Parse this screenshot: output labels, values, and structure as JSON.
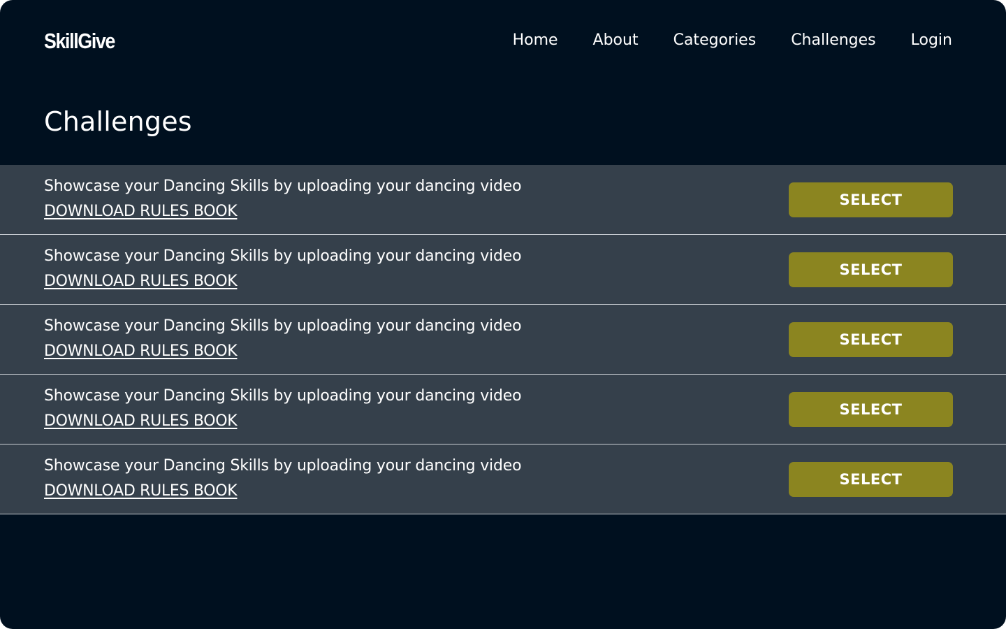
{
  "brand": {
    "name": "SkillGive"
  },
  "nav": {
    "items": [
      {
        "label": "Home"
      },
      {
        "label": "About"
      },
      {
        "label": "Categories"
      },
      {
        "label": "Challenges"
      },
      {
        "label": "Login"
      }
    ]
  },
  "page": {
    "title": "Challenges"
  },
  "challenges": [
    {
      "description": "Showcase your Dancing Skills by uploading your dancing video",
      "link": "DOWNLOAD RULES BOOK",
      "button": "SELECT"
    },
    {
      "description": "Showcase your Dancing Skills by uploading your dancing video",
      "link": "DOWNLOAD RULES BOOK",
      "button": "SELECT"
    },
    {
      "description": "Showcase your Dancing Skills by uploading your dancing video",
      "link": "DOWNLOAD RULES BOOK",
      "button": "SELECT"
    },
    {
      "description": "Showcase your Dancing Skills by uploading your dancing video",
      "link": "DOWNLOAD RULES BOOK",
      "button": "SELECT"
    },
    {
      "description": "Showcase your Dancing Skills by uploading your dancing video",
      "link": "DOWNLOAD RULES BOOK",
      "button": "SELECT"
    }
  ],
  "colors": {
    "background": "#00101f",
    "row_background": "#35404b",
    "row_divider": "#c9ced3",
    "button": "#8b8520",
    "text": "#ffffff"
  }
}
